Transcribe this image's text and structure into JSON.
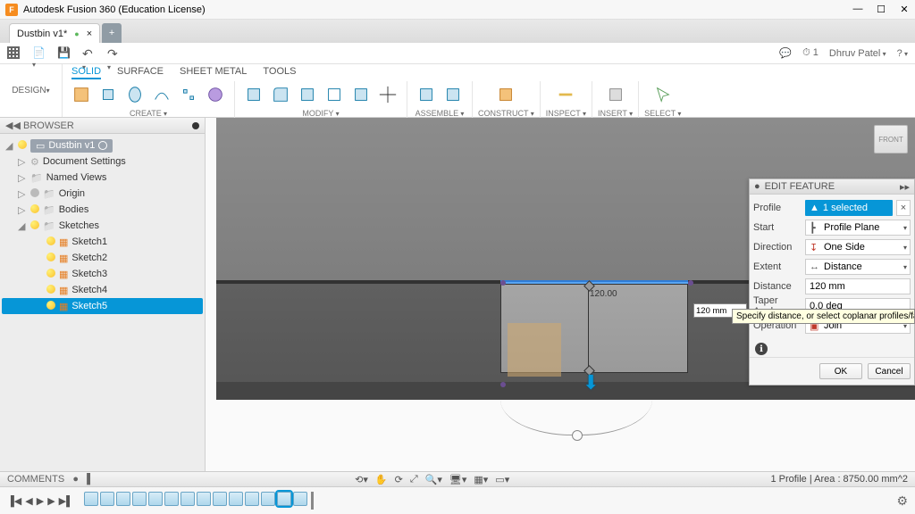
{
  "titlebar": {
    "appName": "Autodesk Fusion 360 (Education License)"
  },
  "document": {
    "tabName": "Dustbin v1*",
    "closeGlyph": "×",
    "newTabGlyph": "+"
  },
  "qat": {
    "jobs": "1",
    "userName": "Dhruv Patel",
    "help": "?"
  },
  "ribbon": {
    "workspace": "DESIGN",
    "tabs": [
      "SOLID",
      "SURFACE",
      "SHEET METAL",
      "TOOLS"
    ],
    "sections": {
      "create": "CREATE",
      "modify": "MODIFY",
      "assemble": "ASSEMBLE",
      "construct": "CONSTRUCT",
      "inspect": "INSPECT",
      "insert": "INSERT",
      "select": "SELECT"
    }
  },
  "browser": {
    "title": "BROWSER",
    "root": "Dustbin v1",
    "items": [
      {
        "label": "Document Settings"
      },
      {
        "label": "Named Views"
      },
      {
        "label": "Origin"
      },
      {
        "label": "Bodies"
      },
      {
        "label": "Sketches"
      }
    ],
    "sketches": [
      "Sketch1",
      "Sketch2",
      "Sketch3",
      "Sketch4",
      "Sketch5"
    ]
  },
  "viewport": {
    "viewcube": "FRONT",
    "dimension": "120.00"
  },
  "editFeature": {
    "title": "EDIT FEATURE",
    "profileLabel": "Profile",
    "profileValue": "1 selected",
    "startLabel": "Start",
    "startValue": "Profile Plane",
    "directionLabel": "Direction",
    "directionValue": "One Side",
    "extentLabel": "Extent",
    "extentValue": "Distance",
    "distanceLabel": "Distance",
    "distanceValue": "120 mm",
    "taperLabel": "Taper Angle",
    "taperValue": "0.0 deg",
    "popupValue": "120 mm",
    "operationLabel": "Operation",
    "operationValue": "Join",
    "tooltip": "Specify distance, or select coplanar profiles/faces to modify the",
    "ok": "OK",
    "cancel": "Cancel"
  },
  "commentsBar": {
    "label": "COMMENTS"
  },
  "status": {
    "text": "1 Profile | Area : 8750.00 mm^2"
  },
  "winControls": {
    "min": "—",
    "max": "☐",
    "close": "✕"
  }
}
